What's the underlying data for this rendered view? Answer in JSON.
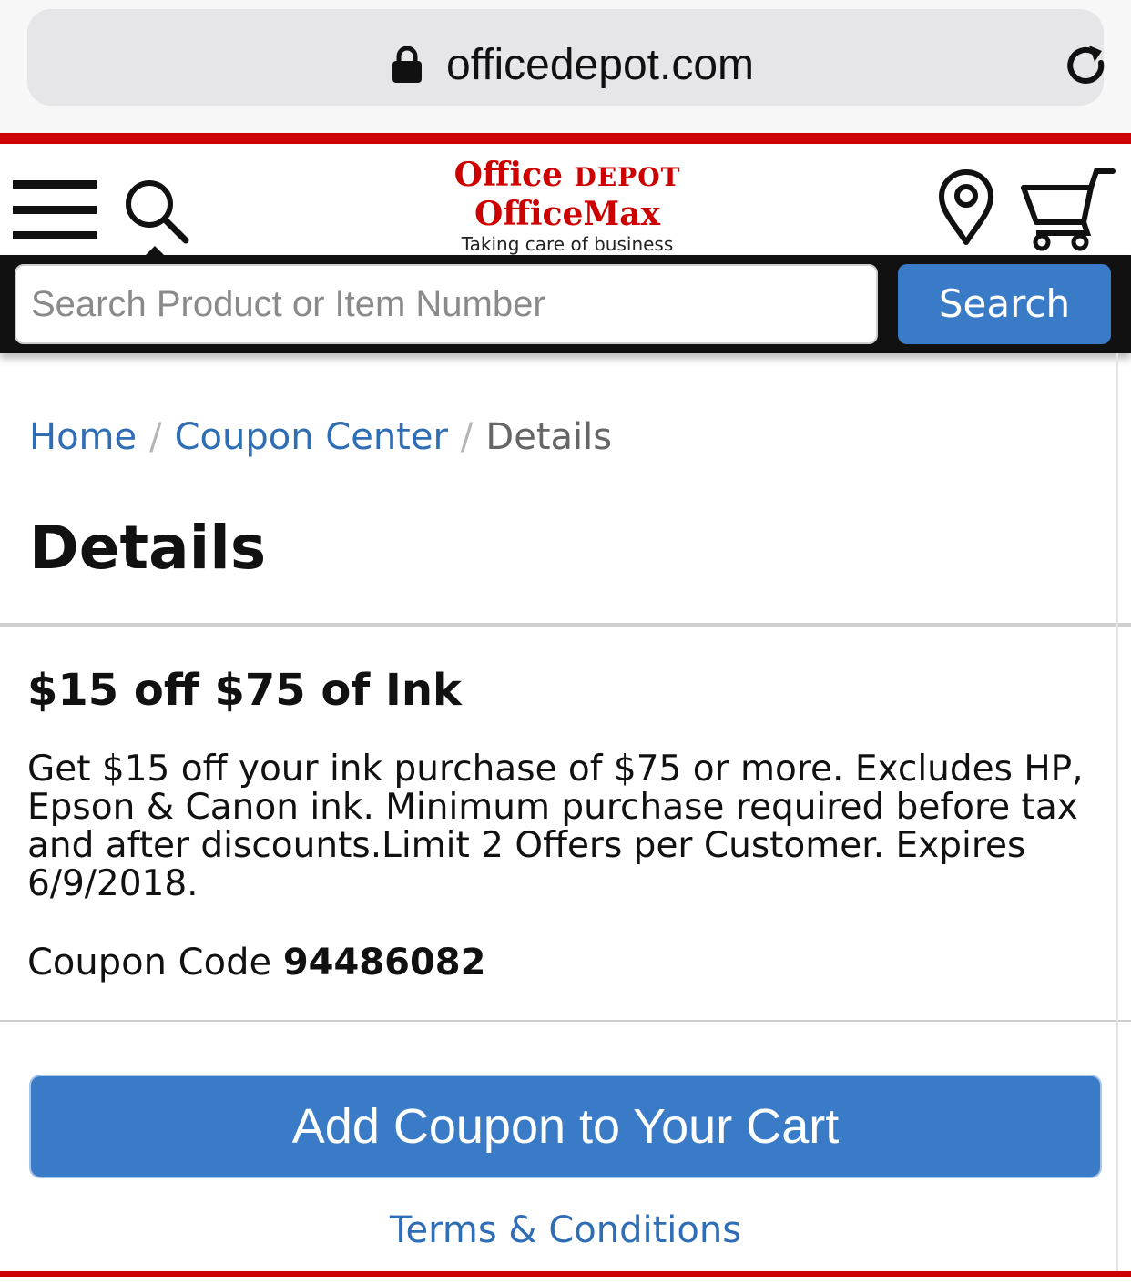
{
  "browser": {
    "url": "officedepot.com",
    "lock_icon": "lock-icon",
    "reload_icon": "reload-icon"
  },
  "header": {
    "logo_line1_a": "Office",
    "logo_line1_b": "DEPOT",
    "logo_line2": "OfficeMax",
    "logo_tagline": "Taking care of business",
    "brand_color": "#cc0000",
    "icons": [
      "menu-icon",
      "search-icon",
      "location-pin-icon",
      "cart-icon"
    ]
  },
  "search": {
    "placeholder": "Search Product or Item Number",
    "value": "",
    "button_label": "Search"
  },
  "breadcrumb": {
    "home": "Home",
    "separator": "/",
    "coupon_center": "Coupon Center",
    "current": "Details"
  },
  "page": {
    "title": "Details"
  },
  "offer": {
    "title": "$15 off $75 of Ink",
    "description": "Get $15 off your ink purchase of $75 or more. Excludes HP, Epson & Canon ink. Minimum purchase required before tax and after discounts.Limit 2 Offers per Customer. Expires 6/9/2018.",
    "coupon_code_label": "Coupon Code",
    "coupon_code_value": "94486082"
  },
  "actions": {
    "add_coupon_label": "Add Coupon to Your Cart",
    "terms_label": "Terms & Conditions"
  },
  "colors": {
    "accent_blue": "#3a7bc8",
    "link_blue": "#2f6db5",
    "brand_red": "#cc0000"
  }
}
